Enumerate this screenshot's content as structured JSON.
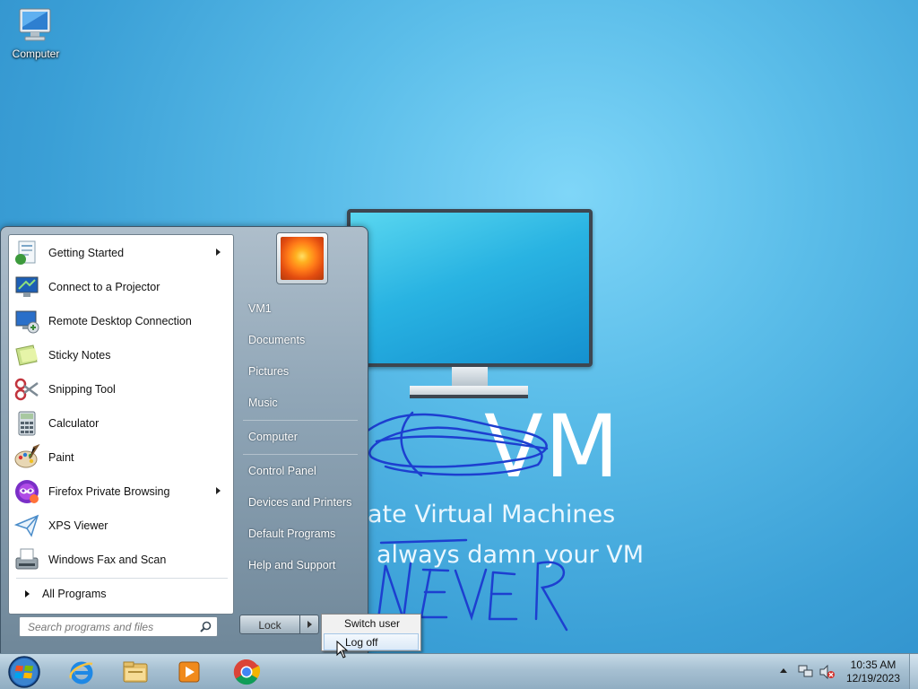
{
  "desktop": {
    "icon_label": "Computer"
  },
  "wallpaper": {
    "brand": "VM",
    "tagline": "ate Virtual Machines",
    "tagline2": "always damn your VM",
    "scribble_text": "NEVER"
  },
  "start_menu": {
    "programs": [
      {
        "label": "Getting Started",
        "icon": "getting-started-icon",
        "has_submenu": true
      },
      {
        "label": "Connect to a Projector",
        "icon": "projector-icon",
        "has_submenu": false
      },
      {
        "label": "Remote Desktop Connection",
        "icon": "remote-desktop-icon",
        "has_submenu": false
      },
      {
        "label": "Sticky Notes",
        "icon": "sticky-notes-icon",
        "has_submenu": false
      },
      {
        "label": "Snipping Tool",
        "icon": "scissors-icon",
        "has_submenu": false
      },
      {
        "label": "Calculator",
        "icon": "calculator-icon",
        "has_submenu": false
      },
      {
        "label": "Paint",
        "icon": "paint-palette-icon",
        "has_submenu": false
      },
      {
        "label": "Firefox Private Browsing",
        "icon": "firefox-private-icon",
        "has_submenu": true
      },
      {
        "label": "XPS Viewer",
        "icon": "xps-viewer-icon",
        "has_submenu": false
      },
      {
        "label": "Windows Fax and Scan",
        "icon": "fax-icon",
        "has_submenu": false
      }
    ],
    "all_programs": "All Programs",
    "search_placeholder": "Search programs and files",
    "right_items": [
      "VM1",
      "Documents",
      "Pictures",
      "Music",
      "Computer",
      "Control Panel",
      "Devices and Printers",
      "Default Programs",
      "Help and Support"
    ],
    "lock_label": "Lock",
    "flyout": [
      "Switch user",
      "Log off"
    ]
  },
  "taskbar": {
    "apps": [
      "internet-explorer-icon",
      "file-explorer-icon",
      "media-player-icon",
      "chrome-icon"
    ],
    "time": "10:35 AM",
    "date": "12/19/2023"
  },
  "colors": {
    "accent": "#3a9fd6",
    "wallpaper_light": "#7fd6f8",
    "scribble": "#1d3fd0"
  }
}
